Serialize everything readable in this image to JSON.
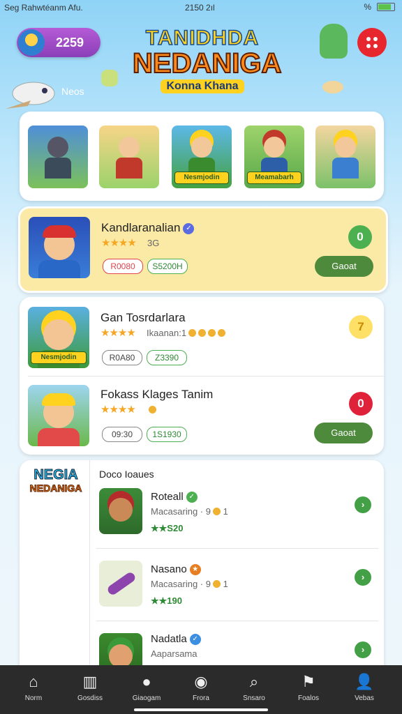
{
  "status_bar": {
    "left": "Seg  Rahwtéanm Afu.",
    "time": "2150 2ıl",
    "right": "%"
  },
  "header": {
    "coins": "2259",
    "logo_line1": "TANIDHDA",
    "logo_line2": "NEDANIGA",
    "logo_line3": "Konna Khana",
    "bird_label": "Neos",
    "menu_icon": "grid-icon"
  },
  "tiles": [
    {
      "label": "",
      "bg": "#4f8fd8"
    },
    {
      "label": "",
      "bg": "#f7d487"
    },
    {
      "label": "Nesmjodin",
      "bg": "#44a13f"
    },
    {
      "label": "Meamabarh",
      "bg": "#58a84a"
    },
    {
      "label": "",
      "bg": "#f4d6a0"
    }
  ],
  "featured": {
    "title": "Kandlaranalian",
    "stars": "★★★★",
    "rating": "3G",
    "pill_a": "R0080",
    "pill_b": "S5200H",
    "circle_label": "0",
    "button": "Gaoat"
  },
  "list": [
    {
      "title": "Gan Tosrdarlara",
      "stars": "★★★★",
      "meta": "Ikaanan:1",
      "thumb_label": "Nesmjodin",
      "pill_a": "R0A80",
      "pill_b": "Z3390",
      "circle_label": "7",
      "button": ""
    },
    {
      "title": "Fokass Klages Tanim",
      "stars": "★★★★",
      "meta": "",
      "thumb_label": "",
      "pill_a": "09:30",
      "pill_b": "1S1930",
      "circle_label": "0",
      "button": "Gaoat"
    }
  ],
  "leagues": {
    "logo_a": "NEGIA",
    "logo_b": "NEDANIGA",
    "heading": "Doco Ioaues",
    "items": [
      {
        "title": "Roteall",
        "meta": "Macasaring · 9",
        "meta_num": "1",
        "score": "★★S20"
      },
      {
        "title": "Nasano",
        "meta": "Macasaring · 9",
        "meta_num": "1",
        "score": "★★190"
      },
      {
        "title": "Nadatla",
        "meta": "Aaparsama",
        "meta_num": "",
        "score": ""
      }
    ]
  },
  "nav": [
    {
      "label": "Norm",
      "icon": "home-icon",
      "glyph": "⌂"
    },
    {
      "label": "Gosdiss",
      "icon": "cards-icon",
      "glyph": "▥"
    },
    {
      "label": "Giaogam",
      "icon": "notifications-icon",
      "glyph": "●"
    },
    {
      "label": "Frora",
      "icon": "profile-circle-icon",
      "glyph": "◉"
    },
    {
      "label": "Snsaro",
      "icon": "search-icon",
      "glyph": "⌕"
    },
    {
      "label": "Foalos",
      "icon": "flag-icon",
      "glyph": "⚑"
    },
    {
      "label": "Vebas",
      "icon": "user-icon",
      "glyph": "👤"
    }
  ]
}
